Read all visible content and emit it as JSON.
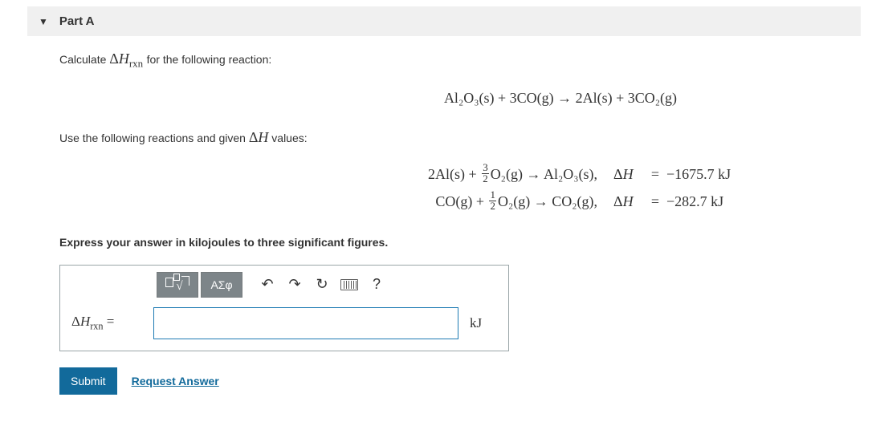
{
  "part": {
    "caret": "▼",
    "title": "Part A"
  },
  "prompt": {
    "text_before": "Calculate ",
    "symbol": "ΔH",
    "subscript": "rxn",
    "text_after": " for the following reaction:"
  },
  "main_equation": "Al₂O₃(s) + 3CO(g) → 2Al(s) + 3CO₂(g)",
  "given_text_before": "Use the following reactions and given ",
  "given_symbol": "ΔH",
  "given_text_after": " values:",
  "hess": [
    {
      "lhs_a": "2Al(s) + ",
      "frac_top": "3",
      "frac_bot": "2",
      "lhs_b": "O₂(g) → Al₂O₃(s),",
      "dH": "ΔH",
      "eq": "=",
      "val": "−1675.7 kJ"
    },
    {
      "lhs_a": "CO(g) + ",
      "frac_top": "1",
      "frac_bot": "2",
      "lhs_b": "O₂(g) → CO₂(g),",
      "dH": "ΔH",
      "eq": "=",
      "val": "−282.7 kJ"
    }
  ],
  "instruction": "Express your answer in kilojoules to three significant figures.",
  "toolbar": {
    "symbols": "ΑΣφ",
    "help": "?"
  },
  "answer": {
    "label_symbol": "ΔH",
    "label_sub": "rxn",
    "label_eq": " =",
    "value": "",
    "unit": "kJ"
  },
  "actions": {
    "submit": "Submit",
    "request": "Request Answer"
  }
}
